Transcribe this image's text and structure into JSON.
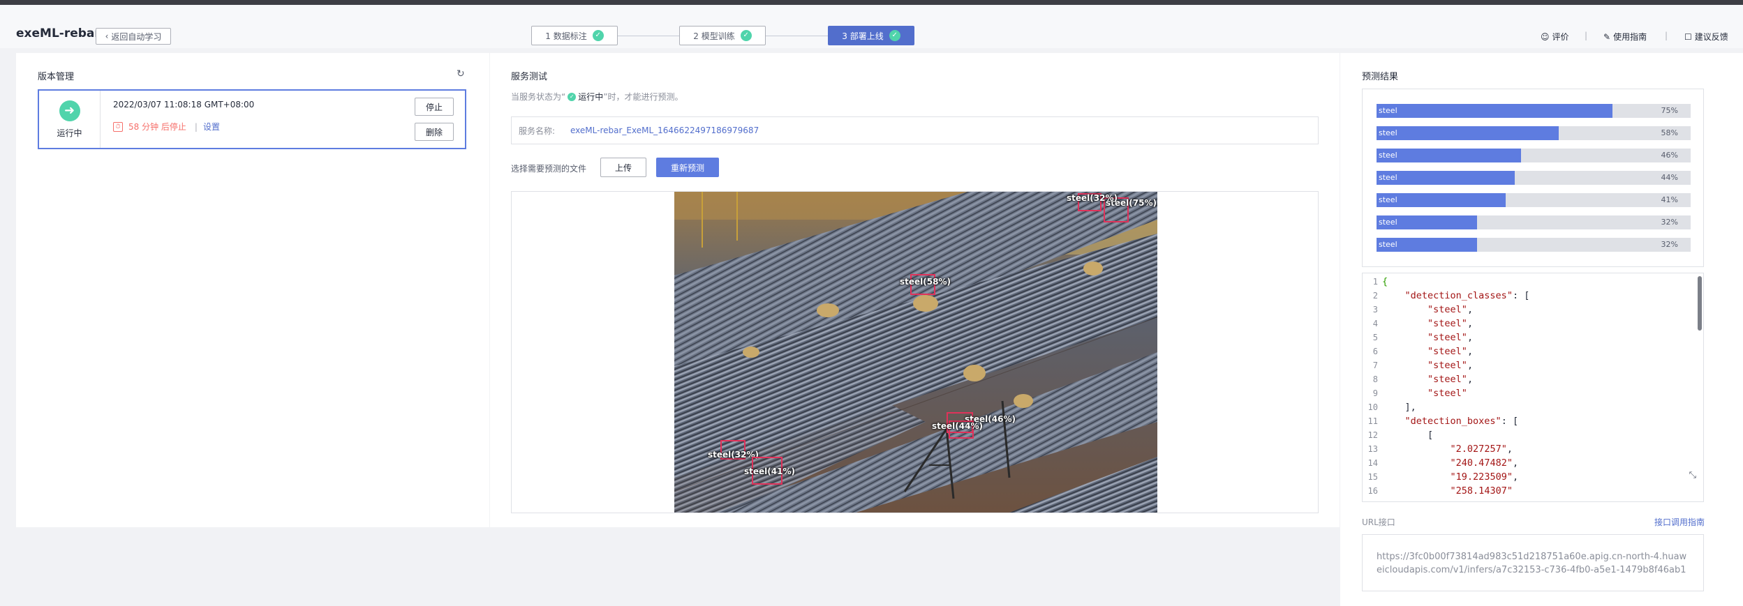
{
  "header": {
    "app_title": "exeML-rebar",
    "back_label": "返回自动学习",
    "steps": [
      {
        "label": "1 数据标注",
        "done": true
      },
      {
        "label": "2 模型训练",
        "done": true
      },
      {
        "label": "3 部署上线",
        "done": true,
        "active": true
      }
    ],
    "links": [
      {
        "label": "评价",
        "icon": "smile-icon"
      },
      {
        "label": "使用指南",
        "icon": "book-icon"
      },
      {
        "label": "建议反馈",
        "icon": "feedback-icon"
      }
    ],
    "separator": "|"
  },
  "version_panel": {
    "title": "版本管理",
    "card": {
      "status": "运行中",
      "timestamp": "2022/03/07 11:08:18 GMT+08:00",
      "countdown": "58 分钟 后停止",
      "separator": "|",
      "settings_link": "设置",
      "stop_label": "停止",
      "delete_label": "删除"
    }
  },
  "service_panel": {
    "title": "服务测试",
    "hint_prefix": "当服务状态为“",
    "hint_status": "运行中",
    "hint_suffix": "”时，才能进行预测。",
    "service_name_label": "服务名称:",
    "service_name_value": "exeML-rebar_ExeML_1646622497186979687",
    "file_label": "选择需要预测的文件",
    "upload_label": "上传",
    "predict_label": "重新预测",
    "detections": [
      {
        "label": "steel(75%)"
      },
      {
        "label": "steel(32%)"
      },
      {
        "label": "steel(58%)"
      },
      {
        "label": "steel(46%)"
      },
      {
        "label": "steel(44%)"
      },
      {
        "label": "steel(32%)"
      },
      {
        "label": "steel(41%)"
      }
    ]
  },
  "results_panel": {
    "title": "预测结果",
    "bars": [
      {
        "label": "steel",
        "value": 0.75,
        "pct": "75%"
      },
      {
        "label": "steel",
        "value": 0.58,
        "pct": "58%"
      },
      {
        "label": "steel",
        "value": 0.46,
        "pct": "46%"
      },
      {
        "label": "steel",
        "value": 0.44,
        "pct": "44%"
      },
      {
        "label": "steel",
        "value": 0.41,
        "pct": "41%"
      },
      {
        "label": "steel",
        "value": 0.32,
        "pct": "32%"
      },
      {
        "label": "steel",
        "value": 0.32,
        "pct": "32%"
      }
    ],
    "code_lines": [
      "{",
      "    \"detection_classes\": [",
      "        \"steel\",",
      "        \"steel\",",
      "        \"steel\",",
      "        \"steel\",",
      "        \"steel\",",
      "        \"steel\",",
      "        \"steel\"",
      "    ],",
      "    \"detection_boxes\": [",
      "        [",
      "            \"2.027257\",",
      "            \"240.47482\",",
      "            \"19.223509\",",
      "            \"258.14307\""
    ],
    "url_label": "URL接口",
    "url_guide_link": "接口调用指南",
    "url_value": "https://3fc0b00f73814ad983c51d218751a60e.apig.cn-north-4.huaweicloudapis.com/v1/infers/a7c32153-c736-4fb0-a5e1-1479b8f46ab1"
  },
  "colors": {
    "primary": "#5e7ce0",
    "success": "#50d4ab",
    "danger": "#e0325a",
    "countdown": "#f66f6a"
  }
}
